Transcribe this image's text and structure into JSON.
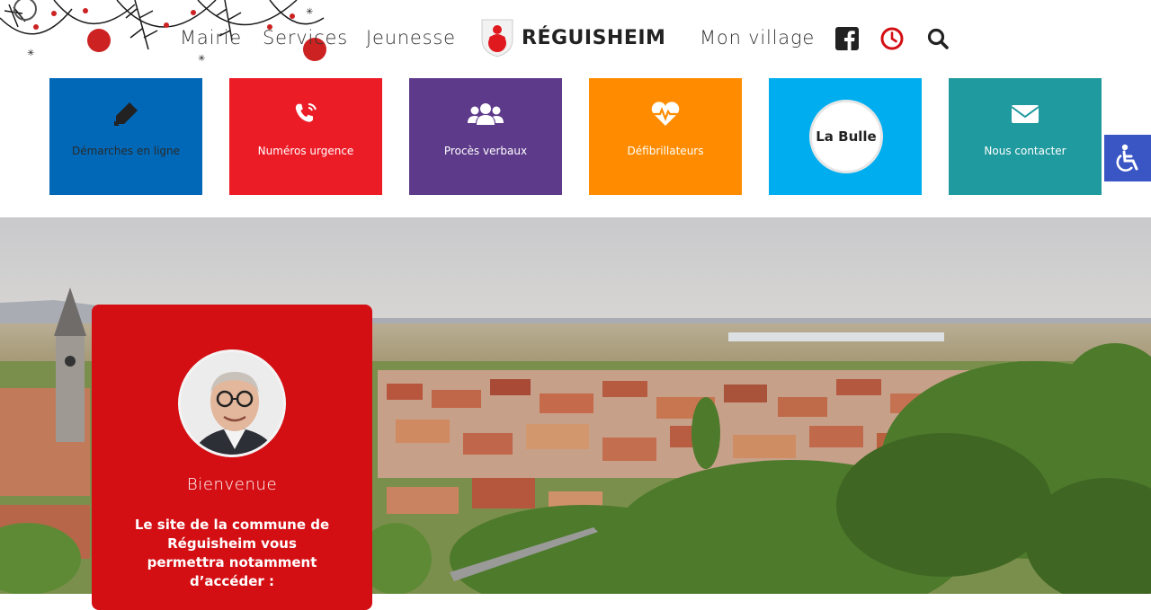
{
  "header": {
    "nav": [
      "Mairie",
      "Services",
      "Jeunesse",
      "Mon village"
    ],
    "logo_title": "RÉGUISHEIM",
    "icons": [
      "facebook-icon",
      "clock-icon",
      "search-icon"
    ],
    "accent": "#d40f14"
  },
  "tiles": [
    {
      "label": "Démarches en ligne",
      "icon": "pen-icon",
      "color": "#0068b7"
    },
    {
      "label": "Numéros urgence",
      "icon": "phone-icon",
      "color": "#ec1c27"
    },
    {
      "label": "Procès verbaux",
      "icon": "users-icon",
      "color": "#5d3a8a"
    },
    {
      "label": "Défibrillateurs",
      "icon": "heartbeat-icon",
      "color": "#ff8c00"
    },
    {
      "label": "La Bulle",
      "icon": "la-bulle-logo",
      "color": "#00aeef"
    },
    {
      "label": "Nous contacter",
      "icon": "envelope-icon",
      "color": "#1f9a9e"
    }
  ],
  "accessibility": {
    "icon": "wheelchair-icon",
    "color": "#3a55c4"
  },
  "welcome": {
    "title": "Bienvenue",
    "text": "Le site de la commune de Réguisheim vous permettra notamment d’accéder :"
  }
}
